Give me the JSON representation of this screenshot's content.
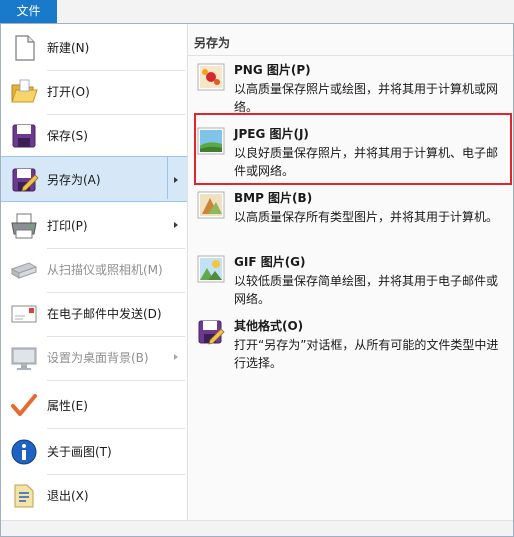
{
  "tabbar": {
    "file_tab_label": "文件"
  },
  "menu_items": [
    {
      "label": "新建(N)",
      "icon": "new-page-icon"
    },
    {
      "label": "打开(O)",
      "icon": "open-folder-icon"
    },
    {
      "label": "保存(S)",
      "icon": "save-disk-icon"
    },
    {
      "label": "另存为(A)",
      "icon": "save-as-icon"
    },
    {
      "label": "打印(P)",
      "icon": "printer-icon"
    },
    {
      "label": "从扫描仪或照相机(M)",
      "icon": "scanner-icon"
    },
    {
      "label": "在电子邮件中发送(D)",
      "icon": "email-icon"
    },
    {
      "label": "设置为桌面背景(B)",
      "icon": "desktop-background-icon"
    },
    {
      "label": "属性(E)",
      "icon": "checkmark-icon"
    },
    {
      "label": "关于画图(T)",
      "icon": "info-icon"
    },
    {
      "label": "退出(X)",
      "icon": "exit-icon"
    }
  ],
  "saveas_panel": {
    "heading": "另存为",
    "options": [
      {
        "title": "PNG 图片(P)",
        "desc": "以高质量保存照片或绘图，并将其用于计算机或网络。",
        "icon": "png-image-icon"
      },
      {
        "title": "JPEG 图片(J)",
        "desc": "以良好质量保存照片，并将其用于计算机、电子邮件或网络。",
        "icon": "jpeg-image-icon"
      },
      {
        "title": "BMP 图片(B)",
        "desc": "以高质量保存所有类型图片，并将其用于计算机。",
        "icon": "bmp-image-icon"
      },
      {
        "title": "GIF 图片(G)",
        "desc": "以较低质量保存简单绘图，并将其用于电子邮件或网络。",
        "icon": "gif-image-icon"
      },
      {
        "title": "其他格式(O)",
        "desc": "打开“另存为”对话框，从所有可能的文件类型中进行选择。",
        "icon": "other-formats-icon"
      }
    ]
  },
  "colors": {
    "accent": "#1979ca",
    "highlight_border": "#e3242b",
    "active_bg": "#d6e7f7"
  }
}
